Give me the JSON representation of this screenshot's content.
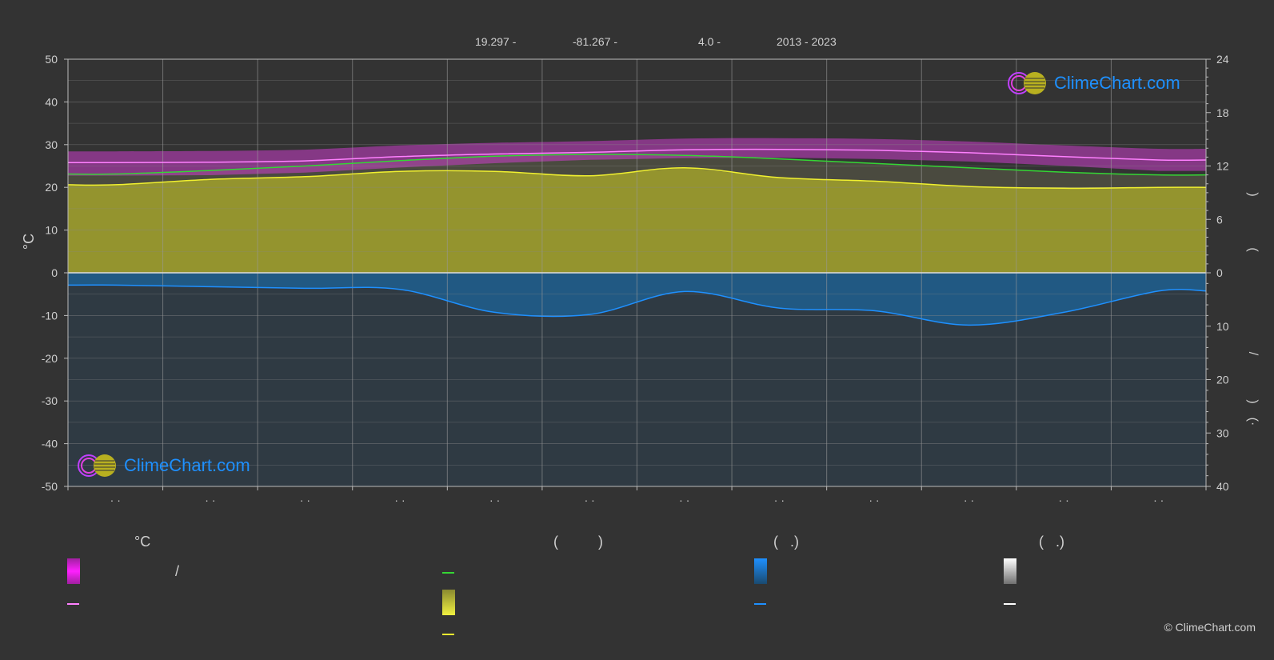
{
  "header": {
    "latitude": "19.297 -",
    "longitude": "-81.267 -",
    "elevation": "4.0 -",
    "years": "2013 - 2023"
  },
  "logo_text": "ClimeChart.com",
  "copyright": "© ClimeChart.com",
  "legend": {
    "col1_head": "°C",
    "col2_head": "(          )",
    "col3_head": "(   .)",
    "col4_head": "(   .)",
    "col1_swatch_label": "/"
  },
  "right_axis_labels": {
    "a": ")",
    "b": "(",
    "c": "/",
    "d": ")",
    "e": "(·"
  },
  "colors": {
    "background": "#333333",
    "temp_range": "#e83fe8",
    "max_temp_line": "#ff80ff",
    "daylight_line": "#34d634",
    "sunshine_fill": "#9a9a2e",
    "sunshine_line": "#f0f030",
    "precip_fill": "#1f5f8f",
    "precip_line": "#1e90ff",
    "snow": "#ffffff"
  },
  "chart_data": {
    "type": "area",
    "title": "",
    "ylabel": "°C",
    "ylim": [
      -50,
      50
    ],
    "yticks": [
      50,
      40,
      30,
      20,
      10,
      0,
      -10,
      -20,
      -30,
      -40,
      -50
    ],
    "ylim_right_hours": [
      0,
      24
    ],
    "yticks_right_top": [
      24,
      18,
      12,
      6,
      0
    ],
    "yticks_right_bottom": [
      10,
      20,
      30,
      40
    ],
    "x_tick_labels": [
      "· ·",
      "· ·",
      "· ·",
      "· ·",
      "· ·",
      "· ·",
      "· ·",
      "· ·",
      "· ·",
      "· ·",
      "· ·",
      "· ·"
    ],
    "months": 12,
    "series": [
      {
        "key": "temp_max",
        "values": [
          25.8,
          25.9,
          26.2,
          27.2,
          27.8,
          28.2,
          28.8,
          28.9,
          28.7,
          28.1,
          27.2,
          26.4
        ]
      },
      {
        "key": "temp_min",
        "values": [
          23.5,
          23.6,
          24.2,
          25.4,
          26.4,
          27.2,
          27.6,
          27.7,
          27.4,
          26.8,
          25.8,
          24.6
        ]
      },
      {
        "key": "daylight_hours",
        "values": [
          11.1,
          11.5,
          12.0,
          12.6,
          13.1,
          13.3,
          13.2,
          12.8,
          12.3,
          11.8,
          11.3,
          11.0
        ]
      },
      {
        "key": "sunshine_hours",
        "values": [
          9.9,
          10.5,
          10.8,
          11.4,
          11.4,
          10.9,
          11.8,
          10.7,
          10.3,
          9.7,
          9.5,
          9.6
        ]
      },
      {
        "key": "precip_mm",
        "values": [
          2.3,
          2.6,
          2.9,
          3.1,
          7.4,
          7.8,
          3.5,
          6.6,
          7.1,
          9.8,
          7.4,
          3.4
        ]
      }
    ],
    "grid": true,
    "legend_position": "bottom"
  }
}
